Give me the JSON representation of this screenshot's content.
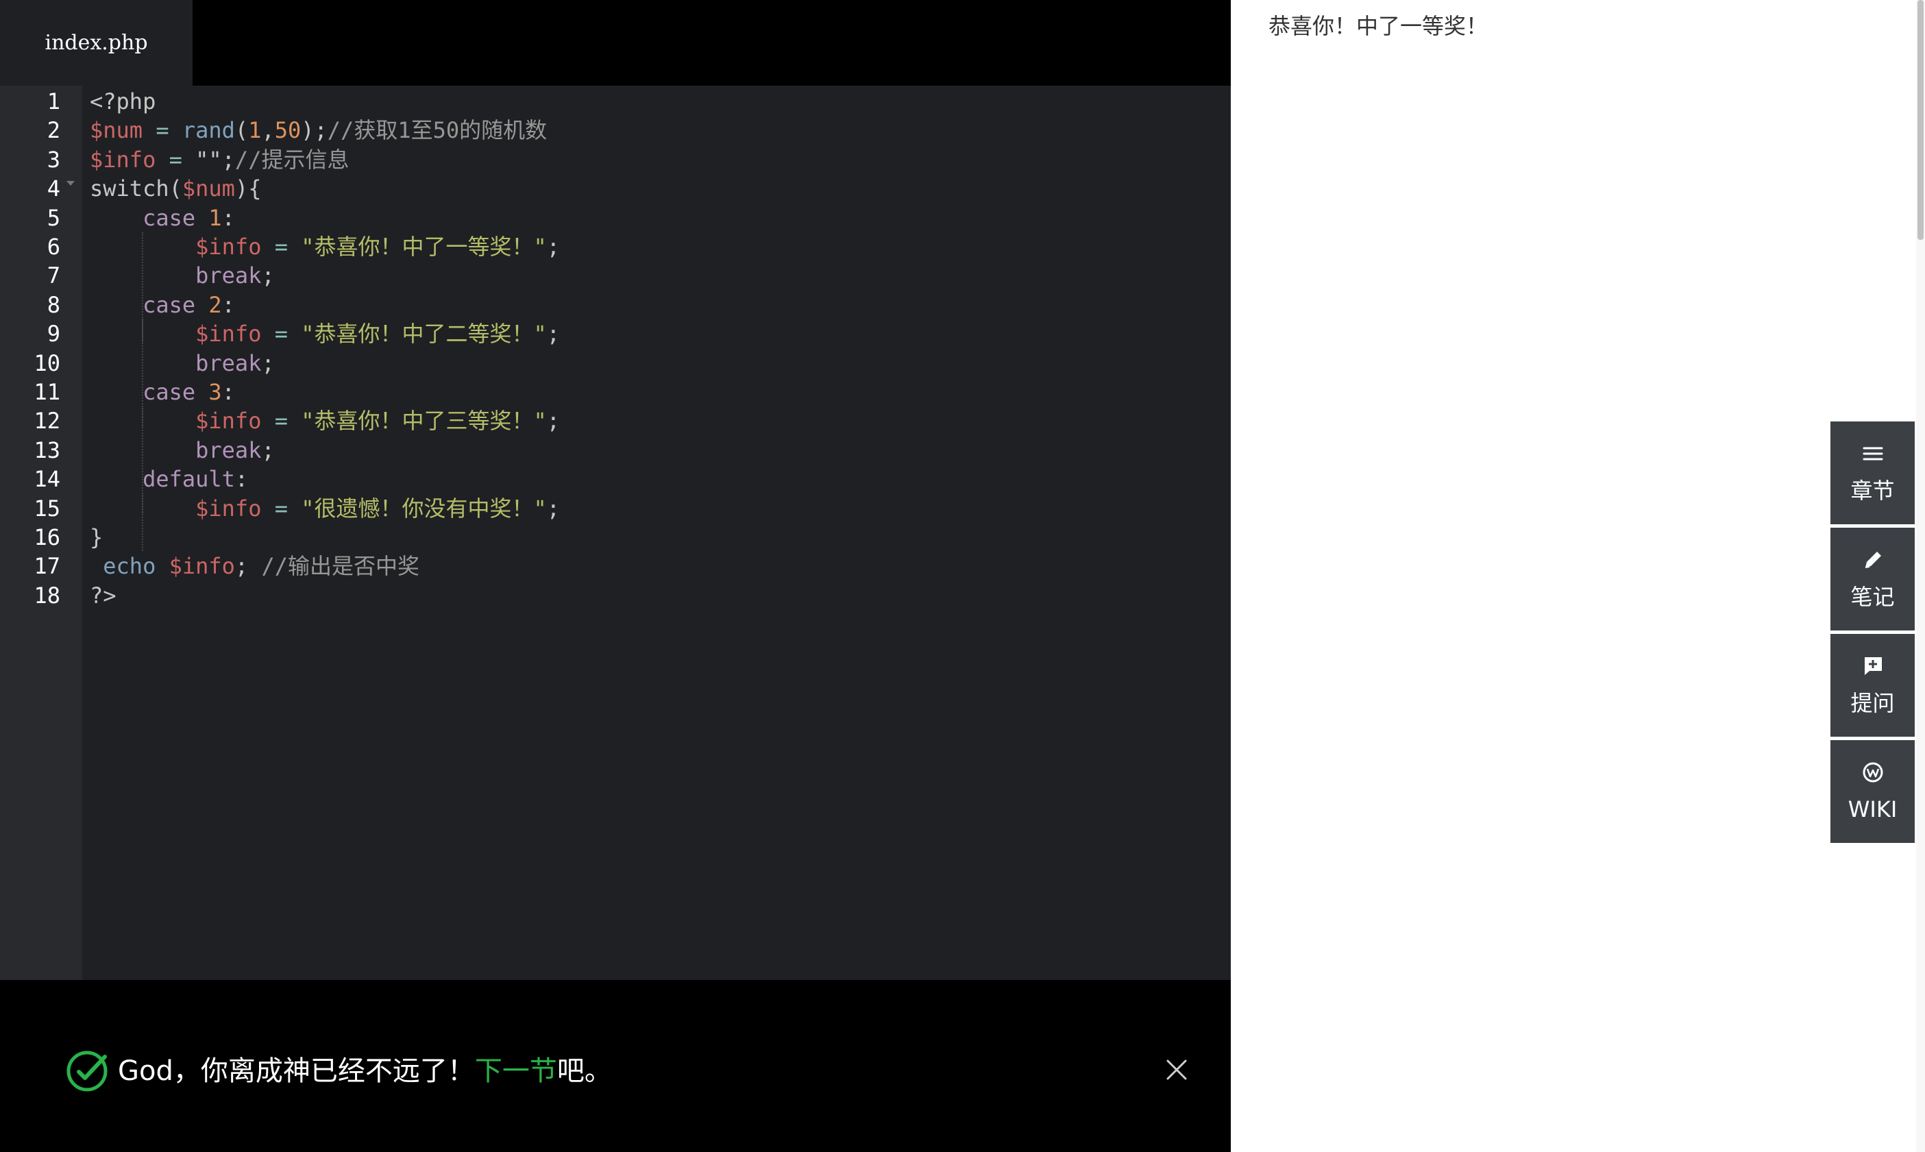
{
  "editor": {
    "tab_label": "index.php",
    "line_numbers": [
      "1",
      "2",
      "3",
      "4",
      "5",
      "6",
      "7",
      "8",
      "9",
      "10",
      "11",
      "12",
      "13",
      "14",
      "15",
      "16",
      "17",
      "18"
    ],
    "code_lines": [
      [
        [
          "plain",
          "<?php"
        ]
      ],
      [
        [
          "var",
          "$num"
        ],
        [
          "plain",
          " "
        ],
        [
          "op",
          "="
        ],
        [
          "plain",
          " "
        ],
        [
          "fn",
          "rand"
        ],
        [
          "plain",
          "("
        ],
        [
          "num",
          "1"
        ],
        [
          "plain",
          ","
        ],
        [
          "num",
          "50"
        ],
        [
          "plain",
          ");"
        ],
        [
          "cmt",
          "//获取1至50的随机数"
        ]
      ],
      [
        [
          "var",
          "$info"
        ],
        [
          "plain",
          " "
        ],
        [
          "op",
          "="
        ],
        [
          "plain",
          " \"\";"
        ],
        [
          "cmt",
          "//提示信息"
        ]
      ],
      [
        [
          "plain",
          "switch("
        ],
        [
          "var",
          "$num"
        ],
        [
          "plain",
          "){"
        ]
      ],
      [
        [
          "plain",
          "    "
        ],
        [
          "kw",
          "case"
        ],
        [
          "plain",
          " "
        ],
        [
          "num",
          "1"
        ],
        [
          "plain",
          ":"
        ]
      ],
      [
        [
          "plain",
          "        "
        ],
        [
          "var",
          "$info"
        ],
        [
          "plain",
          " "
        ],
        [
          "op",
          "="
        ],
        [
          "plain",
          " "
        ],
        [
          "str",
          "\"恭喜你！中了一等奖！\""
        ],
        [
          "plain",
          ";"
        ]
      ],
      [
        [
          "plain",
          "        "
        ],
        [
          "kw",
          "break"
        ],
        [
          "plain",
          ";"
        ]
      ],
      [
        [
          "plain",
          "    "
        ],
        [
          "kw",
          "case"
        ],
        [
          "plain",
          " "
        ],
        [
          "num",
          "2"
        ],
        [
          "plain",
          ":"
        ]
      ],
      [
        [
          "plain",
          "        "
        ],
        [
          "var",
          "$info"
        ],
        [
          "plain",
          " "
        ],
        [
          "op",
          "="
        ],
        [
          "plain",
          " "
        ],
        [
          "str",
          "\"恭喜你！中了二等奖！\""
        ],
        [
          "plain",
          ";"
        ]
      ],
      [
        [
          "plain",
          "        "
        ],
        [
          "kw",
          "break"
        ],
        [
          "plain",
          ";"
        ]
      ],
      [
        [
          "plain",
          "    "
        ],
        [
          "kw",
          "case"
        ],
        [
          "plain",
          " "
        ],
        [
          "num",
          "3"
        ],
        [
          "plain",
          ":"
        ]
      ],
      [
        [
          "plain",
          "        "
        ],
        [
          "var",
          "$info"
        ],
        [
          "plain",
          " "
        ],
        [
          "op",
          "="
        ],
        [
          "plain",
          " "
        ],
        [
          "str",
          "\"恭喜你！中了三等奖！\""
        ],
        [
          "plain",
          ";"
        ]
      ],
      [
        [
          "plain",
          "        "
        ],
        [
          "kw",
          "break"
        ],
        [
          "plain",
          ";"
        ]
      ],
      [
        [
          "plain",
          "    "
        ],
        [
          "kw",
          "default"
        ],
        [
          "plain",
          ":"
        ]
      ],
      [
        [
          "plain",
          "        "
        ],
        [
          "var",
          "$info"
        ],
        [
          "plain",
          " "
        ],
        [
          "op",
          "="
        ],
        [
          "plain",
          " "
        ],
        [
          "str",
          "\"很遗憾！你没有中奖！\""
        ],
        [
          "plain",
          ";"
        ]
      ],
      [
        [
          "plain",
          "}"
        ]
      ],
      [
        [
          "plain",
          " "
        ],
        [
          "fn",
          "echo"
        ],
        [
          "plain",
          " "
        ],
        [
          "var",
          "$info"
        ],
        [
          "plain",
          "; "
        ],
        [
          "cmt",
          "//输出是否中奖"
        ]
      ],
      [
        [
          "plain",
          "?>"
        ]
      ]
    ]
  },
  "result": {
    "prefix": "God，你离成神已经不远了！",
    "link": "下一节",
    "suffix": "吧。",
    "success_color": "#29b34a"
  },
  "output": {
    "text": "恭喜你！中了一等奖！"
  },
  "tools": [
    {
      "label": "章节",
      "icon": "menu-icon"
    },
    {
      "label": "笔记",
      "icon": "pencil-icon"
    },
    {
      "label": "提问",
      "icon": "question-icon"
    },
    {
      "label": "WIKI",
      "icon": "wiki-icon"
    }
  ],
  "colors": {
    "editor_bg": "#1f2023",
    "gutter_bg": "#282a2e",
    "tool_bg": "#3c4045",
    "accent_green": "#29b34a"
  }
}
